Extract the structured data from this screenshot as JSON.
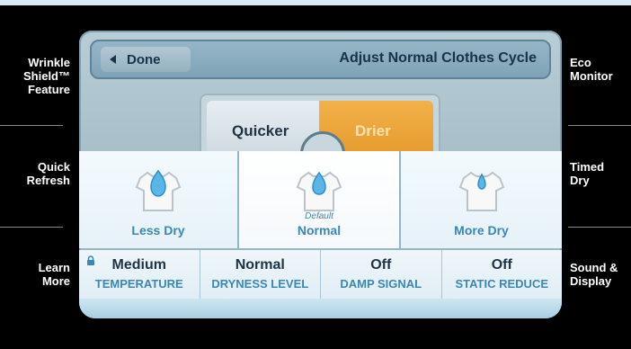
{
  "side_left": [
    {
      "label": "Wrinkle\nShield™\nFeature"
    },
    {
      "label": "Quick\nRefresh"
    },
    {
      "label": "Learn\nMore"
    }
  ],
  "side_right": [
    {
      "label": "Eco\nMonitor"
    },
    {
      "label": "Timed\nDry"
    },
    {
      "label": "Sound &\nDisplay"
    }
  ],
  "header": {
    "done_label": "Done",
    "title": "Adjust Normal Clothes Cycle"
  },
  "toggle": {
    "left_label": "Quicker",
    "right_label": "Drier"
  },
  "dryness": {
    "options": [
      {
        "label": "Less Dry"
      },
      {
        "label": "Normal",
        "default_label": "Default"
      },
      {
        "label": "More Dry"
      }
    ],
    "selected": "Normal"
  },
  "settings": [
    {
      "value": "Medium",
      "name": "TEMPERATURE"
    },
    {
      "value": "Normal",
      "name": "DRYNESS LEVEL"
    },
    {
      "value": "Off",
      "name": "DAMP SIGNAL"
    },
    {
      "value": "Off",
      "name": "STATIC REDUCE"
    }
  ],
  "icons": {
    "done": "chevron-left-icon",
    "lock": "lock-icon",
    "shirt": "shirt-icon",
    "drop": "water-drop-icon"
  }
}
